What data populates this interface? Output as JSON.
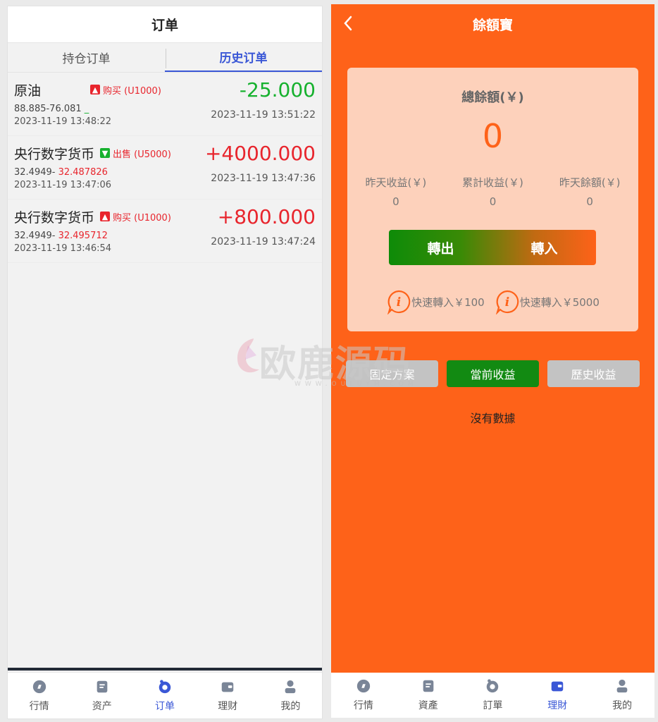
{
  "left": {
    "header_title": "订单",
    "tabs": [
      "持仓订单",
      "历史订单"
    ],
    "orders": [
      {
        "name": "原油",
        "badge_icon": "arrow-up",
        "badge": "购买 (U1000)",
        "amount": "-25.000",
        "price_a": "88.885-76.081",
        "price_b": " _",
        "time_open": "2023-11-19 13:48:22",
        "time_close": "2023-11-19 13:51:22"
      },
      {
        "name": "央行数字货币",
        "badge_icon": "arrow-down",
        "badge": "出售 (U5000)",
        "amount": "+4000.000",
        "price_a": "32.4949-",
        "price_b": " 32.487826",
        "time_open": "2023-11-19 13:47:06",
        "time_close": "2023-11-19 13:47:36"
      },
      {
        "name": "央行数字货币",
        "badge_icon": "arrow-up",
        "badge": "购买 (U1000)",
        "amount": "+800.000",
        "price_a": "32.4949-",
        "price_b": " 32.495712",
        "time_open": "2023-11-19 13:46:54",
        "time_close": "2023-11-19 13:47:24"
      }
    ],
    "tabbar": [
      "行情",
      "资产",
      "订单",
      "理财",
      "我的"
    ]
  },
  "right": {
    "header_title": "餘額寶",
    "card": {
      "title": "總餘額(￥)",
      "total": "0",
      "stats": [
        {
          "label": "昨天收益(￥)",
          "value": "0"
        },
        {
          "label": "累計收益(￥)",
          "value": "0"
        },
        {
          "label": "昨天餘額(￥)",
          "value": "0"
        }
      ],
      "transfer_out": "轉出",
      "transfer_in": "轉入",
      "quick": [
        "快速轉入￥100",
        "快速轉入￥5000"
      ]
    },
    "segments": [
      "固定方案",
      "當前收益",
      "歷史收益"
    ],
    "empty_text": "沒有數據",
    "tabbar": [
      "行情",
      "資產",
      "訂單",
      "理財",
      "我的"
    ]
  },
  "watermark": {
    "text": "欧鹿源码",
    "sub": "WWW.OULUYM.COM"
  },
  "colors": {
    "accent_blue": "#3a57d6",
    "orange": "#fe6219",
    "green": "#16b12e",
    "red": "#e8252d",
    "dark_green": "#128a12"
  }
}
